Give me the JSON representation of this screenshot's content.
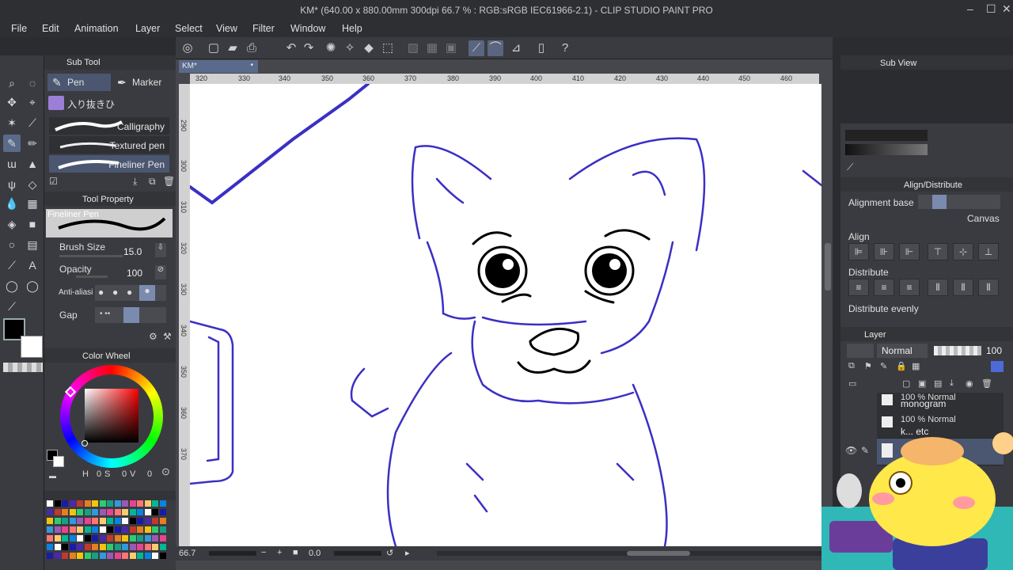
{
  "window": {
    "title": "KM* (640.00 x 880.00mm 300dpi 66.7 % : RGB:sRGB IEC61966-2.1) - CLIP STUDIO PAINT PRO"
  },
  "menu": [
    "File",
    "Edit",
    "Animation",
    "Layer",
    "Select",
    "View",
    "Filter",
    "Window",
    "Help"
  ],
  "subtool": {
    "header": "Sub Tool",
    "tabs": [
      "Pen",
      "Marker"
    ],
    "group_name": "入り抜きひ",
    "brushes": [
      "Calligraphy",
      "Textured pen",
      "Fineliner Pen"
    ]
  },
  "tool_property": {
    "header": "Tool Property",
    "brush_name": "Fineliner Pen",
    "brush_size_label": "Brush Size",
    "brush_size_value": "15.0",
    "opacity_label": "Opacity",
    "opacity_value": "100",
    "antialias_label": "Anti-aliasi",
    "gap_label": "Gap"
  },
  "color_wheel": {
    "header": "Color Wheel",
    "h_label": "H",
    "h_value": "0",
    "s_label": "S",
    "s_value": "0",
    "v_label": "V",
    "v_value": "0",
    "main_color": "#000000",
    "sub_color": "#ffffff"
  },
  "document_tab": "KM*",
  "ruler_top": [
    "320",
    "330",
    "340",
    "350",
    "360",
    "370",
    "380",
    "390",
    "400",
    "410",
    "420",
    "430",
    "440",
    "450",
    "460"
  ],
  "ruler_left": [
    "290",
    "300",
    "310",
    "320",
    "330",
    "340",
    "350",
    "360",
    "370"
  ],
  "status": {
    "zoom": "66.7",
    "rotation": "0.0"
  },
  "sub_view": {
    "header": "Sub View"
  },
  "align": {
    "header": "Align/Distribute",
    "alignment_base_label": "Alignment base",
    "alignment_base_value": "Canvas",
    "align_label": "Align",
    "distribute_label": "Distribute",
    "distribute_evenly_label": "Distribute evenly"
  },
  "layer": {
    "header": "Layer",
    "blend_mode": "Normal",
    "opacity": "100",
    "rows": [
      {
        "line1": "100 % Normal",
        "line2": "monogram"
      },
      {
        "line1": "100 % Normal",
        "line2": "k... etc"
      },
      {
        "line1": "",
        "line2": ""
      }
    ]
  },
  "colors": {
    "accent": "#5b6a8a",
    "stroke_blue": "#3b2fc4",
    "ink": "#000000"
  }
}
